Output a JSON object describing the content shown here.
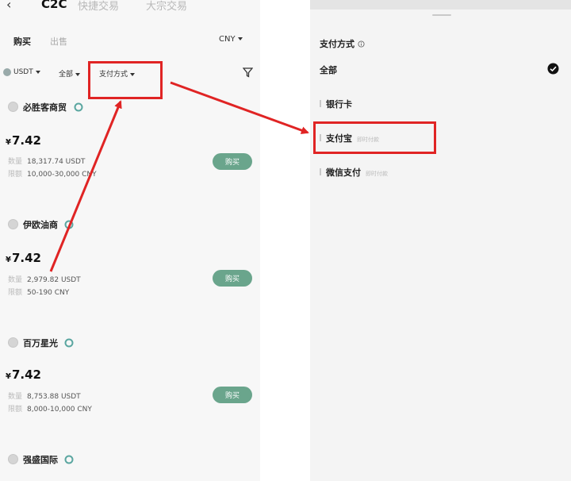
{
  "left": {
    "header": {
      "tab_c2c": "C2C",
      "tab_quick": "快捷交易",
      "tab_block": "大宗交易"
    },
    "trade_tabs": {
      "buy": "购买",
      "sell": "出售"
    },
    "currency": "CNY",
    "filters": {
      "coin": "USDT",
      "all": "全部",
      "payment": "支付方式"
    },
    "merchants": [
      {
        "name": "必胜客商贸",
        "price_symbol": "¥",
        "price": "7.42",
        "qty_label": "数量",
        "qty": "18,317.74 USDT",
        "limit_label": "限额",
        "limit": "10,000-30,000 CNY",
        "buy_label": "购买"
      },
      {
        "name": "伊欧油商",
        "price_symbol": "¥",
        "price": "7.42",
        "qty_label": "数量",
        "qty": "2,979.82 USDT",
        "limit_label": "限额",
        "limit": "50-190 CNY",
        "buy_label": "购买"
      },
      {
        "name": "百万星光",
        "price_symbol": "¥",
        "price": "7.42",
        "qty_label": "数量",
        "qty": "8,753.88 USDT",
        "limit_label": "限额",
        "limit": "8,000-10,000 CNY",
        "buy_label": "购买"
      },
      {
        "name": "强盛国际"
      }
    ]
  },
  "right": {
    "title": "支付方式",
    "options": [
      {
        "label": "全部",
        "selected": true
      },
      {
        "label": "银行卡"
      },
      {
        "label": "支付宝",
        "tag": "即时付款"
      },
      {
        "label": "微信支付",
        "tag": "即时付款"
      }
    ]
  },
  "colors": {
    "annotation_red": "#e02424",
    "buy_button": "#6aa58c"
  }
}
